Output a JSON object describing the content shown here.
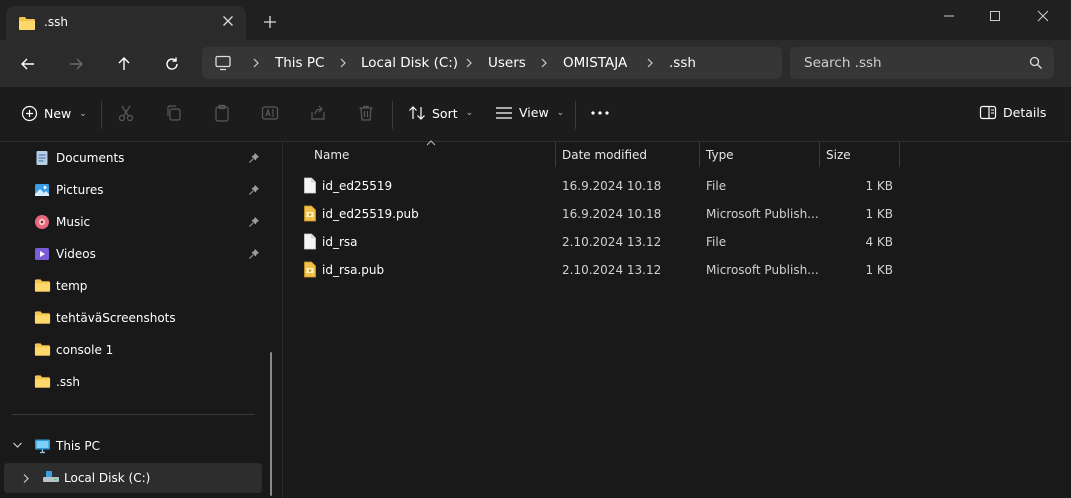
{
  "window": {
    "tab_title": ".ssh"
  },
  "address": {
    "crumbs": [
      "This PC",
      "Local Disk (C:)",
      "Users",
      "OMISTAJA",
      ".ssh"
    ]
  },
  "search": {
    "placeholder": "Search .ssh"
  },
  "commandbar": {
    "new_label": "New",
    "sort_label": "Sort",
    "view_label": "View",
    "details_label": "Details"
  },
  "sidebar": {
    "items": [
      {
        "label": "Documents",
        "icon": "documents-icon"
      },
      {
        "label": "Pictures",
        "icon": "pictures-icon"
      },
      {
        "label": "Music",
        "icon": "music-icon"
      },
      {
        "label": "Videos",
        "icon": "videos-icon"
      },
      {
        "label": "temp",
        "icon": "folder-icon"
      },
      {
        "label": "tehtäväScreenshots",
        "icon": "folder-icon"
      },
      {
        "label": "console 1",
        "icon": "folder-icon"
      },
      {
        "label": ".ssh",
        "icon": "folder-icon"
      }
    ],
    "this_pc": "This PC",
    "local_disk": "Local Disk (C:)"
  },
  "filelist": {
    "columns": [
      "Name",
      "Date modified",
      "Type",
      "Size"
    ],
    "rows": [
      {
        "name": "id_ed25519",
        "date": "16.9.2024 10.18",
        "type": "File",
        "size": "1 KB",
        "icon": "file-icon"
      },
      {
        "name": "id_ed25519.pub",
        "date": "16.9.2024 10.18",
        "type": "Microsoft Publish...",
        "size": "1 KB",
        "icon": "publisher-icon"
      },
      {
        "name": "id_rsa",
        "date": "2.10.2024 13.12",
        "type": "File",
        "size": "4 KB",
        "icon": "file-icon"
      },
      {
        "name": "id_rsa.pub",
        "date": "2.10.2024 13.12",
        "type": "Microsoft Publish...",
        "size": "1 KB",
        "icon": "publisher-icon"
      }
    ]
  },
  "colors": {
    "folder": "#f4c44f",
    "accent": "#4cc2ff"
  }
}
